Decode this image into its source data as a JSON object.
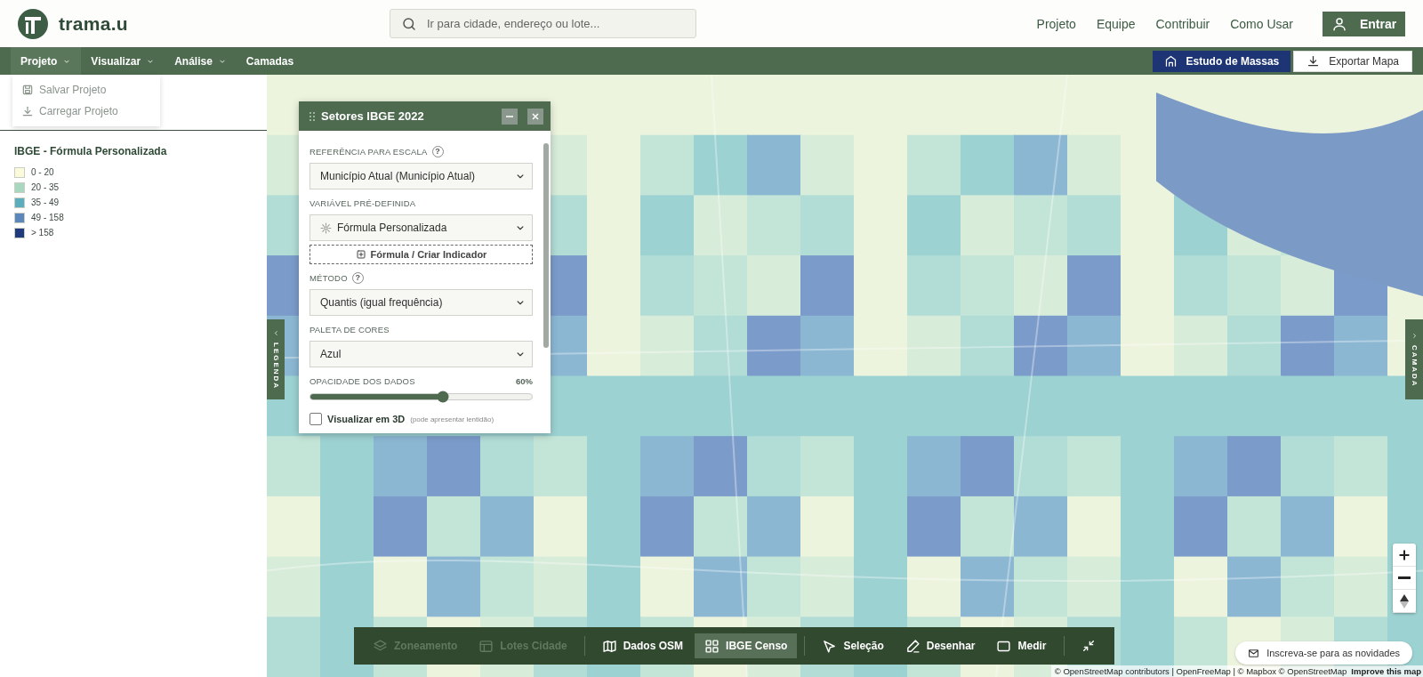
{
  "header": {
    "logo": "trama.u",
    "search": {
      "placeholder": "Ir para cidade, endereço ou lote..."
    },
    "links": [
      "Projeto",
      "Equipe",
      "Contribuir",
      "Como Usar"
    ],
    "login": "Entrar"
  },
  "menubar": {
    "items": [
      {
        "label": "Projeto",
        "expanded": true
      },
      {
        "label": "Visualizar",
        "expanded": false
      },
      {
        "label": "Análise",
        "expanded": false
      },
      {
        "label": "Camadas",
        "expanded": false
      }
    ],
    "actions": [
      {
        "kind": "primary",
        "label": "Estudo de Massas"
      },
      {
        "kind": "secondary",
        "label": "Exportar Mapa"
      }
    ]
  },
  "project_menu": [
    {
      "kind": "save",
      "label": "Salvar Projeto"
    },
    {
      "kind": "load",
      "label": "Carregar Projeto"
    }
  ],
  "legend": {
    "title": "IBGE - Fórmula Personalizada",
    "items": [
      {
        "label": "0 - 20",
        "color": "#fbfbdc"
      },
      {
        "label": "20 - 35",
        "color": "#a8d9c0"
      },
      {
        "label": "35 - 49",
        "color": "#5aaebd"
      },
      {
        "label": "49 - 158",
        "color": "#5b87bd"
      },
      {
        "label": "> 158",
        "color": "#1f3b7e"
      }
    ]
  },
  "side_tabs": {
    "left": "LEGENDA",
    "right": "CAMADA"
  },
  "panel": {
    "title": "Setores IBGE 2022",
    "fields": [
      {
        "kind": "select",
        "label": "REFERÊNCIA PARA ESCALA",
        "help": "?",
        "value": "Município Atual (Município Atual)"
      },
      {
        "kind": "select",
        "label": "VARIÁVEL PRÉ-DEFINIDA",
        "value": "Fórmula Personalizada",
        "icon": true
      },
      {
        "kind": "action",
        "label": "Fórmula / Criar Indicador"
      },
      {
        "kind": "select",
        "label": "MÉTODO",
        "help": "?",
        "value": "Quantis (igual frequência)"
      },
      {
        "kind": "select",
        "label": "PALETA DE CORES",
        "value": "Azul"
      }
    ],
    "opacity": {
      "label": "OPACIDADE DOS DADOS",
      "reading": "60%",
      "level": 0.6
    },
    "checkbox": {
      "label": "Visualizar em 3D",
      "note": "(pode apresentar lentidão)",
      "checked": false
    }
  },
  "toolbar": [
    {
      "kind": "layers",
      "label": "Zoneamento",
      "disabled": true,
      "selected": false
    },
    {
      "kind": "table",
      "label": "Lotes Cidade",
      "disabled": true,
      "selected": false
    },
    {
      "kind": "sep"
    },
    {
      "kind": "map",
      "label": "Dados OSM",
      "disabled": false,
      "selected": false
    },
    {
      "kind": "grid",
      "label": "IBGE Censo",
      "disabled": false,
      "selected": true
    },
    {
      "kind": "sep"
    },
    {
      "kind": "cursor",
      "label": "Seleção",
      "disabled": false,
      "selected": false
    },
    {
      "kind": "pen",
      "label": "Desenhar",
      "disabled": false,
      "selected": false
    },
    {
      "kind": "rect",
      "label": "Medir",
      "disabled": false,
      "selected": false
    },
    {
      "kind": "sep"
    },
    {
      "kind": "collapse"
    }
  ],
  "newsletter": "Inscreva-se para as novidades",
  "attribution": {
    "text": "© OpenStreetMap contributors | OpenFreeMap | © Mapbox © OpenStreetMap",
    "link": "Improve this map"
  }
}
